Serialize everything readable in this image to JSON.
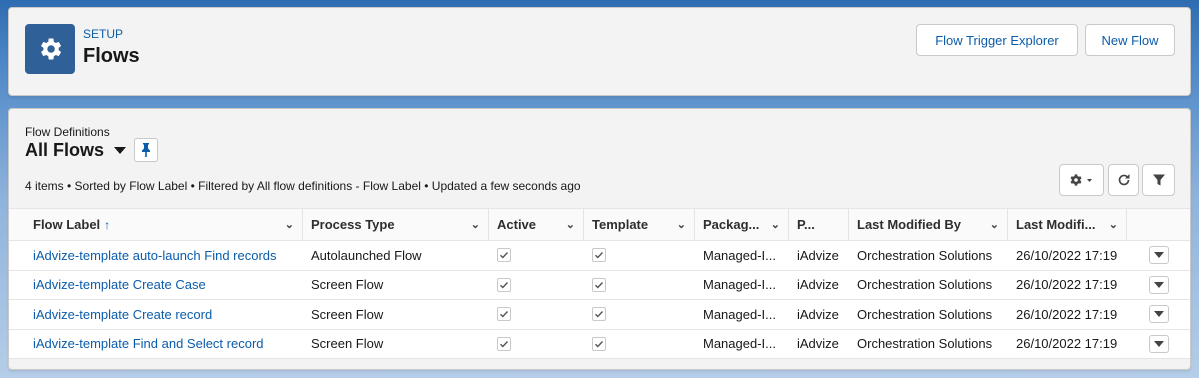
{
  "header": {
    "eyebrow": "SETUP",
    "title": "Flows",
    "icon": "gear-icon",
    "buttons": {
      "trigger_explorer": "Flow Trigger Explorer",
      "new_flow": "New Flow"
    }
  },
  "list_view": {
    "object_label": "Flow Definitions",
    "view_name": "All Flows",
    "status": "4 items • Sorted by Flow Label • Filtered by All flow definitions - Flow Label • Updated a few seconds ago"
  },
  "table": {
    "columns": [
      {
        "label": "Flow Label",
        "sort": "↑"
      },
      {
        "label": "Process Type"
      },
      {
        "label": "Active"
      },
      {
        "label": "Template"
      },
      {
        "label": "Packag..."
      },
      {
        "label": "P..."
      },
      {
        "label": "Last Modified By"
      },
      {
        "label": "Last Modifi..."
      }
    ],
    "rows": [
      {
        "flow_label": "iAdvize-template auto-launch Find records",
        "process_type": "Autolaunched Flow",
        "active": true,
        "template": true,
        "package": "Managed-I...",
        "p": "iAdvize",
        "modified_by": "Orchestration Solutions",
        "modified_date": "26/10/2022 17:19"
      },
      {
        "flow_label": "iAdvize-template Create Case",
        "process_type": "Screen Flow",
        "active": true,
        "template": true,
        "package": "Managed-I...",
        "p": "iAdvize",
        "modified_by": "Orchestration Solutions",
        "modified_date": "26/10/2022 17:19"
      },
      {
        "flow_label": "iAdvize-template Create record",
        "process_type": "Screen Flow",
        "active": true,
        "template": true,
        "package": "Managed-I...",
        "p": "iAdvize",
        "modified_by": "Orchestration Solutions",
        "modified_date": "26/10/2022 17:19"
      },
      {
        "flow_label": "iAdvize-template Find and Select record",
        "process_type": "Screen Flow",
        "active": true,
        "template": true,
        "package": "Managed-I...",
        "p": "iAdvize",
        "modified_by": "Orchestration Solutions",
        "modified_date": "26/10/2022 17:19"
      }
    ]
  },
  "colors": {
    "brand_blue": "#0b5cab",
    "icon_bg": "#306098"
  }
}
